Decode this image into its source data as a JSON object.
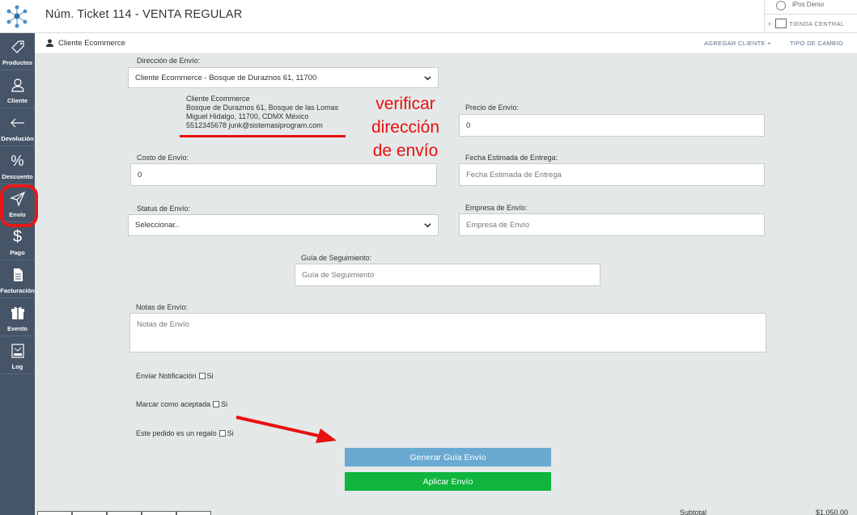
{
  "header": {
    "title": "Núm. Ticket 114 - VENTA REGULAR",
    "user": "iPos Demo",
    "store": "TIENDA CENTRAL"
  },
  "sidebar": {
    "items": [
      {
        "label": "Productos",
        "icon": "tag-icon"
      },
      {
        "label": "Cliente",
        "icon": "user-icon"
      },
      {
        "label": "Devolución",
        "icon": "arrow-left-icon"
      },
      {
        "label": "Descuento",
        "icon": "percent-icon"
      },
      {
        "label": "Envío",
        "icon": "paper-plane-icon"
      },
      {
        "label": "Pago",
        "icon": "dollar-icon"
      },
      {
        "label": "Facturación",
        "icon": "document-icon"
      },
      {
        "label": "Evento",
        "icon": "gift-icon"
      },
      {
        "label": "Log",
        "icon": "log-icon"
      }
    ],
    "active": "Envío"
  },
  "subheader": {
    "client": "Cliente Ecommerce",
    "add_client": "AGREGAR CLIENTE +",
    "exchange": "TIPO DE CAMBIO"
  },
  "form": {
    "address_label": "Dirección de Envío:",
    "address_value": "Cliente Ecommerce - Bosque de Duraznos 61, 11700",
    "address_lines": [
      "Cliente Ecommerce",
      "Bosque de Duraznos 61, Bosque de las Lomas",
      "Miguel Hidalgo, 11700, CDMX México",
      "5512345678 junk@sistemasiprogram.com"
    ],
    "price_label": "Precio de Envío:",
    "price_value": "0",
    "cost_label": "Costo de Envío:",
    "cost_value": "0",
    "date_label": "Fecha Estimada de Entrega:",
    "date_placeholder": "Fecha Estimada de Entrega",
    "status_label": "Status de Envío:",
    "status_value": "Seleccionar..",
    "company_label": "Empresa de Envío:",
    "company_placeholder": "Empresa de Envío",
    "tracking_label": "Guía de Seguimiento:",
    "tracking_placeholder": "Guía de Seguimiento",
    "notes_label": "Notas de Envío:",
    "notes_placeholder": "Notas de Envío",
    "notify_label": "Enviar Notificación",
    "accept_label": "Marcar como aceptada",
    "gift_label": "Este pedido es un regalo",
    "yes": "Si",
    "generate_button": "Generar Guía Envío",
    "apply_button": "Aplicar Envío"
  },
  "annotation": {
    "text_lines": [
      "verificar",
      "dirección",
      "de envío"
    ],
    "color": "#e81010"
  },
  "footer": {
    "subtotal_label": "Subtotal",
    "subtotal_value": "$1,050.00"
  }
}
